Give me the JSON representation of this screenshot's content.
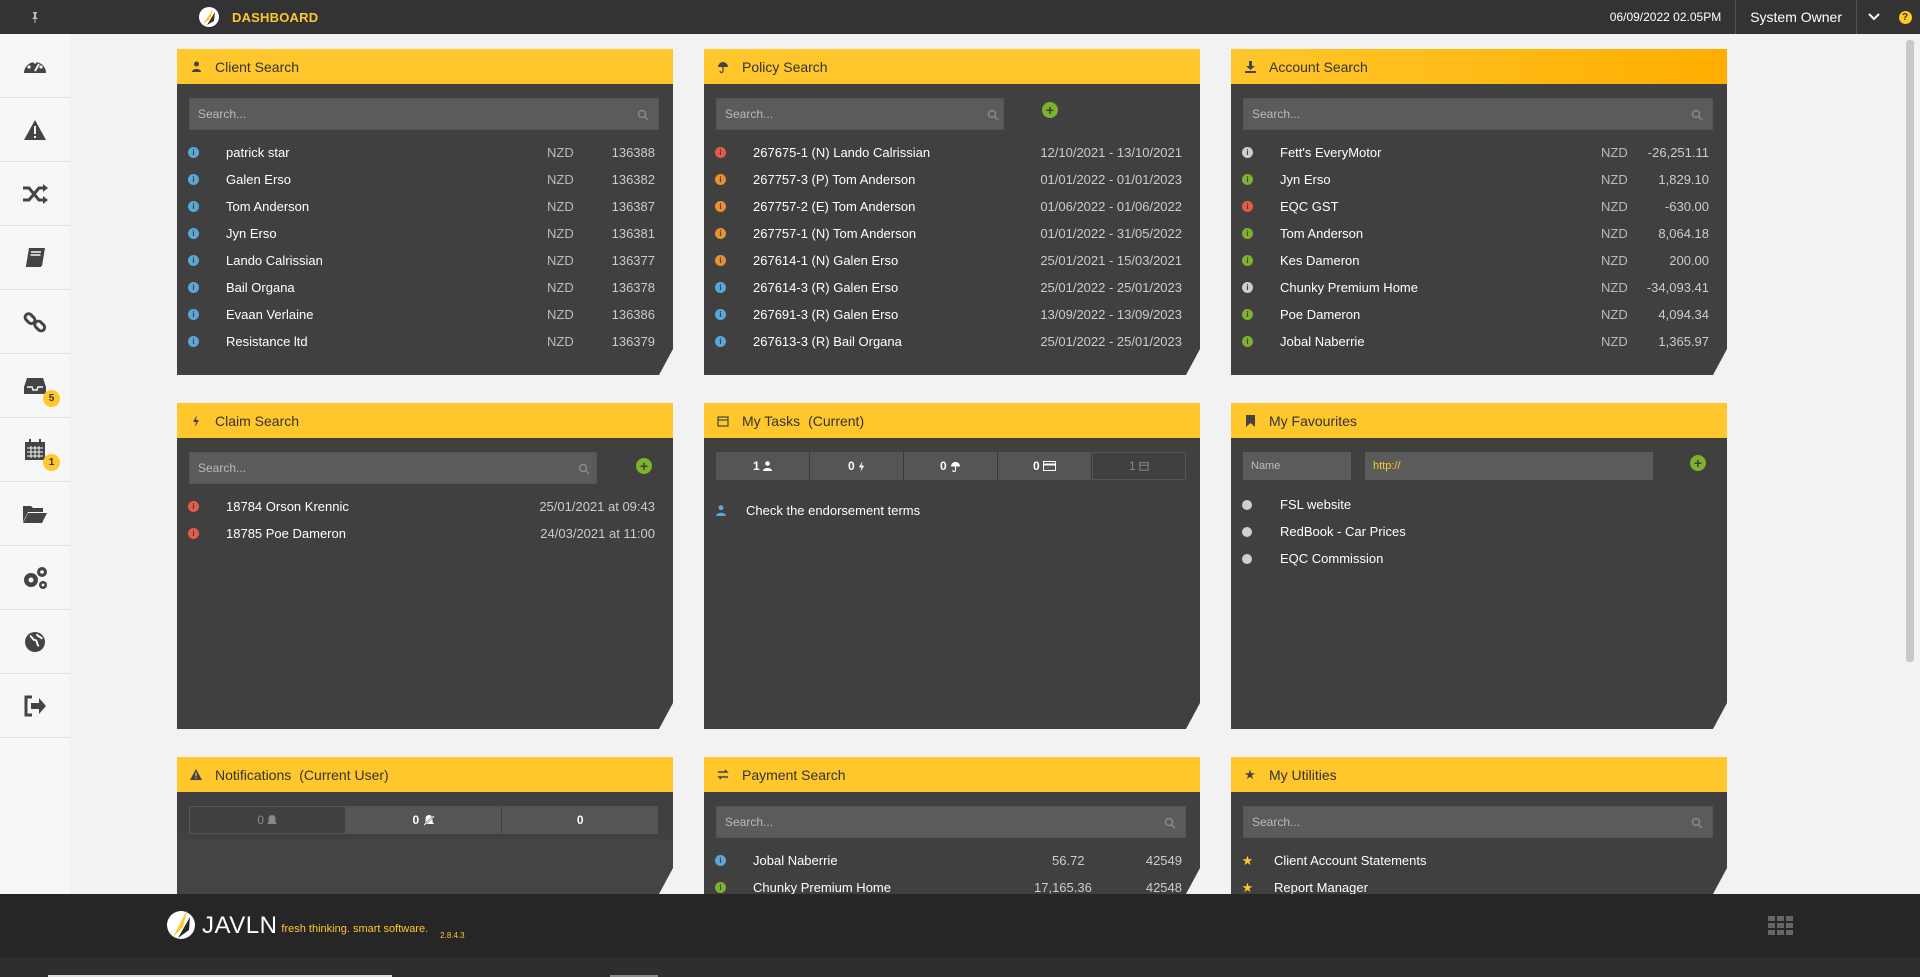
{
  "topbar": {
    "title": "DASHBOARD",
    "datetime": "06/09/2022 02.05PM",
    "user": "System Owner",
    "help": "?"
  },
  "sidebar": {
    "items": [
      {
        "icon": "dashboard-icon",
        "badge": ""
      },
      {
        "icon": "alert-icon",
        "badge": ""
      },
      {
        "icon": "shuffle-icon",
        "badge": ""
      },
      {
        "icon": "book-icon",
        "badge": ""
      },
      {
        "icon": "link-icon",
        "badge": ""
      },
      {
        "icon": "inbox-icon",
        "badge": "5"
      },
      {
        "icon": "calendar-icon",
        "badge": "1"
      },
      {
        "icon": "folder-icon",
        "badge": ""
      },
      {
        "icon": "gears-icon",
        "badge": ""
      },
      {
        "icon": "globe-icon",
        "badge": ""
      },
      {
        "icon": "logout-icon",
        "badge": ""
      }
    ]
  },
  "client_search": {
    "title": "Client Search",
    "placeholder": "Search...",
    "rows": [
      {
        "name": "patrick star",
        "cur": "NZD",
        "id": "136388"
      },
      {
        "name": "Galen Erso",
        "cur": "NZD",
        "id": "136382"
      },
      {
        "name": "Tom Anderson",
        "cur": "NZD",
        "id": "136387"
      },
      {
        "name": "Jyn Erso",
        "cur": "NZD",
        "id": "136381"
      },
      {
        "name": "Lando Calrissian",
        "cur": "NZD",
        "id": "136377"
      },
      {
        "name": "Bail Organa",
        "cur": "NZD",
        "id": "136378"
      },
      {
        "name": "Evaan Verlaine",
        "cur": "NZD",
        "id": "136386"
      },
      {
        "name": "Resistance ltd",
        "cur": "NZD",
        "id": "136379"
      }
    ]
  },
  "policy_search": {
    "title": "Policy Search",
    "placeholder": "Search...",
    "rows": [
      {
        "name": "267675-1 (N) Lando Calrissian",
        "dates": "12/10/2021 - 13/10/2021",
        "status": "red"
      },
      {
        "name": "267757-3 (P) Tom Anderson",
        "dates": "01/01/2022 - 01/01/2023",
        "status": "orange"
      },
      {
        "name": "267757-2 (E) Tom Anderson",
        "dates": "01/06/2022 - 01/06/2022",
        "status": "orange"
      },
      {
        "name": "267757-1 (N) Tom Anderson",
        "dates": "01/01/2022 - 31/05/2022",
        "status": "orange"
      },
      {
        "name": "267614-1 (N) Galen Erso",
        "dates": "25/01/2021 - 15/03/2021",
        "status": "orange"
      },
      {
        "name": "267614-3 (R) Galen Erso",
        "dates": "25/01/2022 - 25/01/2023",
        "status": "blue"
      },
      {
        "name": "267691-3 (R) Galen Erso",
        "dates": "13/09/2022 - 13/09/2023",
        "status": "blue"
      },
      {
        "name": "267613-3 (R) Bail Organa",
        "dates": "25/01/2022 - 25/01/2023",
        "status": "blue"
      }
    ]
  },
  "account_search": {
    "title": "Account Search",
    "placeholder": "Search...",
    "rows": [
      {
        "name": "Fett's EveryMotor",
        "cur": "NZD",
        "amount": "-26,251.11",
        "status": "grey"
      },
      {
        "name": "Jyn Erso",
        "cur": "NZD",
        "amount": "1,829.10",
        "status": "green"
      },
      {
        "name": "EQC GST",
        "cur": "NZD",
        "amount": "-630.00",
        "status": "red"
      },
      {
        "name": "Tom Anderson",
        "cur": "NZD",
        "amount": "8,064.18",
        "status": "green"
      },
      {
        "name": "Kes Dameron",
        "cur": "NZD",
        "amount": "200.00",
        "status": "green"
      },
      {
        "name": "Chunky Premium Home",
        "cur": "NZD",
        "amount": "-34,093.41",
        "status": "grey"
      },
      {
        "name": "Poe Dameron",
        "cur": "NZD",
        "amount": "4,094.34",
        "status": "green"
      },
      {
        "name": "Jobal Naberrie",
        "cur": "NZD",
        "amount": "1,365.97",
        "status": "green"
      }
    ]
  },
  "claim_search": {
    "title": "Claim Search",
    "placeholder": "Search...",
    "rows": [
      {
        "name": "18784 Orson Krennic",
        "date": "25/01/2021 at 09:43"
      },
      {
        "name": "18785 Poe Dameron",
        "date": "24/03/2021 at 11:00"
      }
    ]
  },
  "my_tasks": {
    "title": "My Tasks",
    "subtitle": "(Current)",
    "counts": [
      "1",
      "0",
      "0",
      "0",
      "1"
    ],
    "rows": [
      {
        "text": "Check the endorsement terms"
      }
    ]
  },
  "my_favourites": {
    "title": "My Favourites",
    "name_placeholder": "Name",
    "url_value": "http://",
    "rows": [
      {
        "text": "FSL website"
      },
      {
        "text": "RedBook - Car Prices"
      },
      {
        "text": "EQC Commission"
      }
    ]
  },
  "notifications": {
    "title": "Notifications",
    "subtitle": "(Current User)",
    "counts": [
      "0",
      "0",
      "0"
    ]
  },
  "payment_search": {
    "title": "Payment Search",
    "placeholder": "Search...",
    "rows": [
      {
        "name": "Jobal Naberrie",
        "amount": "56.72",
        "id": "42549",
        "status": "blue"
      },
      {
        "name": "Chunky Premium Home",
        "amount": "17,165.36",
        "id": "42548",
        "status": "green"
      }
    ]
  },
  "my_utilities": {
    "title": "My Utilities",
    "placeholder": "Search...",
    "rows": [
      {
        "text": "Client Account Statements"
      },
      {
        "text": "Report Manager"
      }
    ]
  },
  "footer": {
    "logo": "JAVLN",
    "tagline": "fresh thinking. smart software.",
    "version": "2.8.4.3"
  },
  "colors": {
    "accent": "#ffc72c",
    "panel": "#404040",
    "topbar": "#333333",
    "footer": "#262626"
  }
}
